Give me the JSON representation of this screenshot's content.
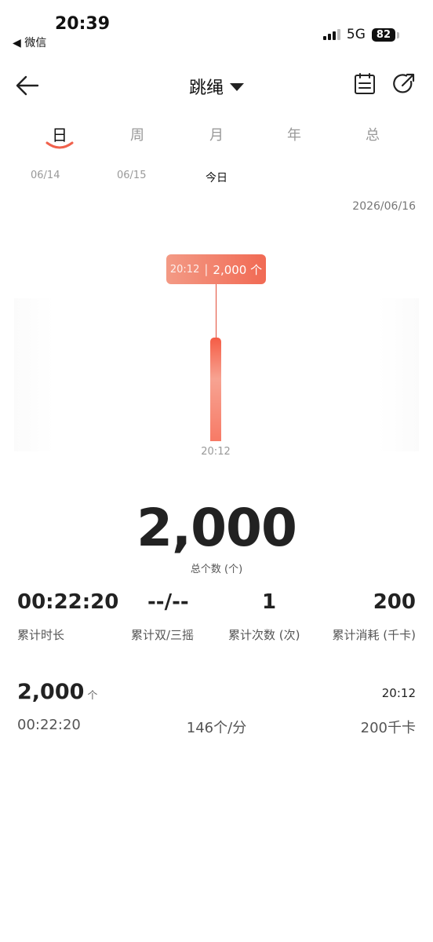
{
  "status_bar": {
    "time": "20:39",
    "back_app": "◀ 微信",
    "network": "5G",
    "battery": "82"
  },
  "header": {
    "title": "跳绳"
  },
  "tabs": [
    {
      "label": "日",
      "active": true
    },
    {
      "label": "周",
      "active": false
    },
    {
      "label": "月",
      "active": false
    },
    {
      "label": "年",
      "active": false
    },
    {
      "label": "总",
      "active": false
    }
  ],
  "dates": [
    {
      "label": "06/14"
    },
    {
      "label": "06/15"
    },
    {
      "label": "今日",
      "selected": true
    }
  ],
  "current_date": "2026/06/16",
  "tooltip": {
    "time": "20:12",
    "value": "2,000 个"
  },
  "chart_data": {
    "type": "bar",
    "categories": [
      "20:12"
    ],
    "values": [
      2000
    ],
    "title": "",
    "xlabel": "",
    "ylabel": "",
    "grid": false,
    "colors": {
      "bar": "#f55c45",
      "tooltip": "#f16a54"
    }
  },
  "total": {
    "value": "2,000",
    "label": "总个数 (个)"
  },
  "stats": [
    {
      "value": "00:22:20",
      "label": "累计时长"
    },
    {
      "value": "--/--",
      "label": "累计双/三摇"
    },
    {
      "value": "1",
      "label": "累计次数 (次)"
    },
    {
      "value": "200",
      "label": "累计消耗 (千卡)"
    }
  ],
  "record": {
    "count": "2,000",
    "unit": "个",
    "time": "20:12",
    "duration": "00:22:20",
    "rate": "146个/分",
    "calories": "200千卡"
  }
}
